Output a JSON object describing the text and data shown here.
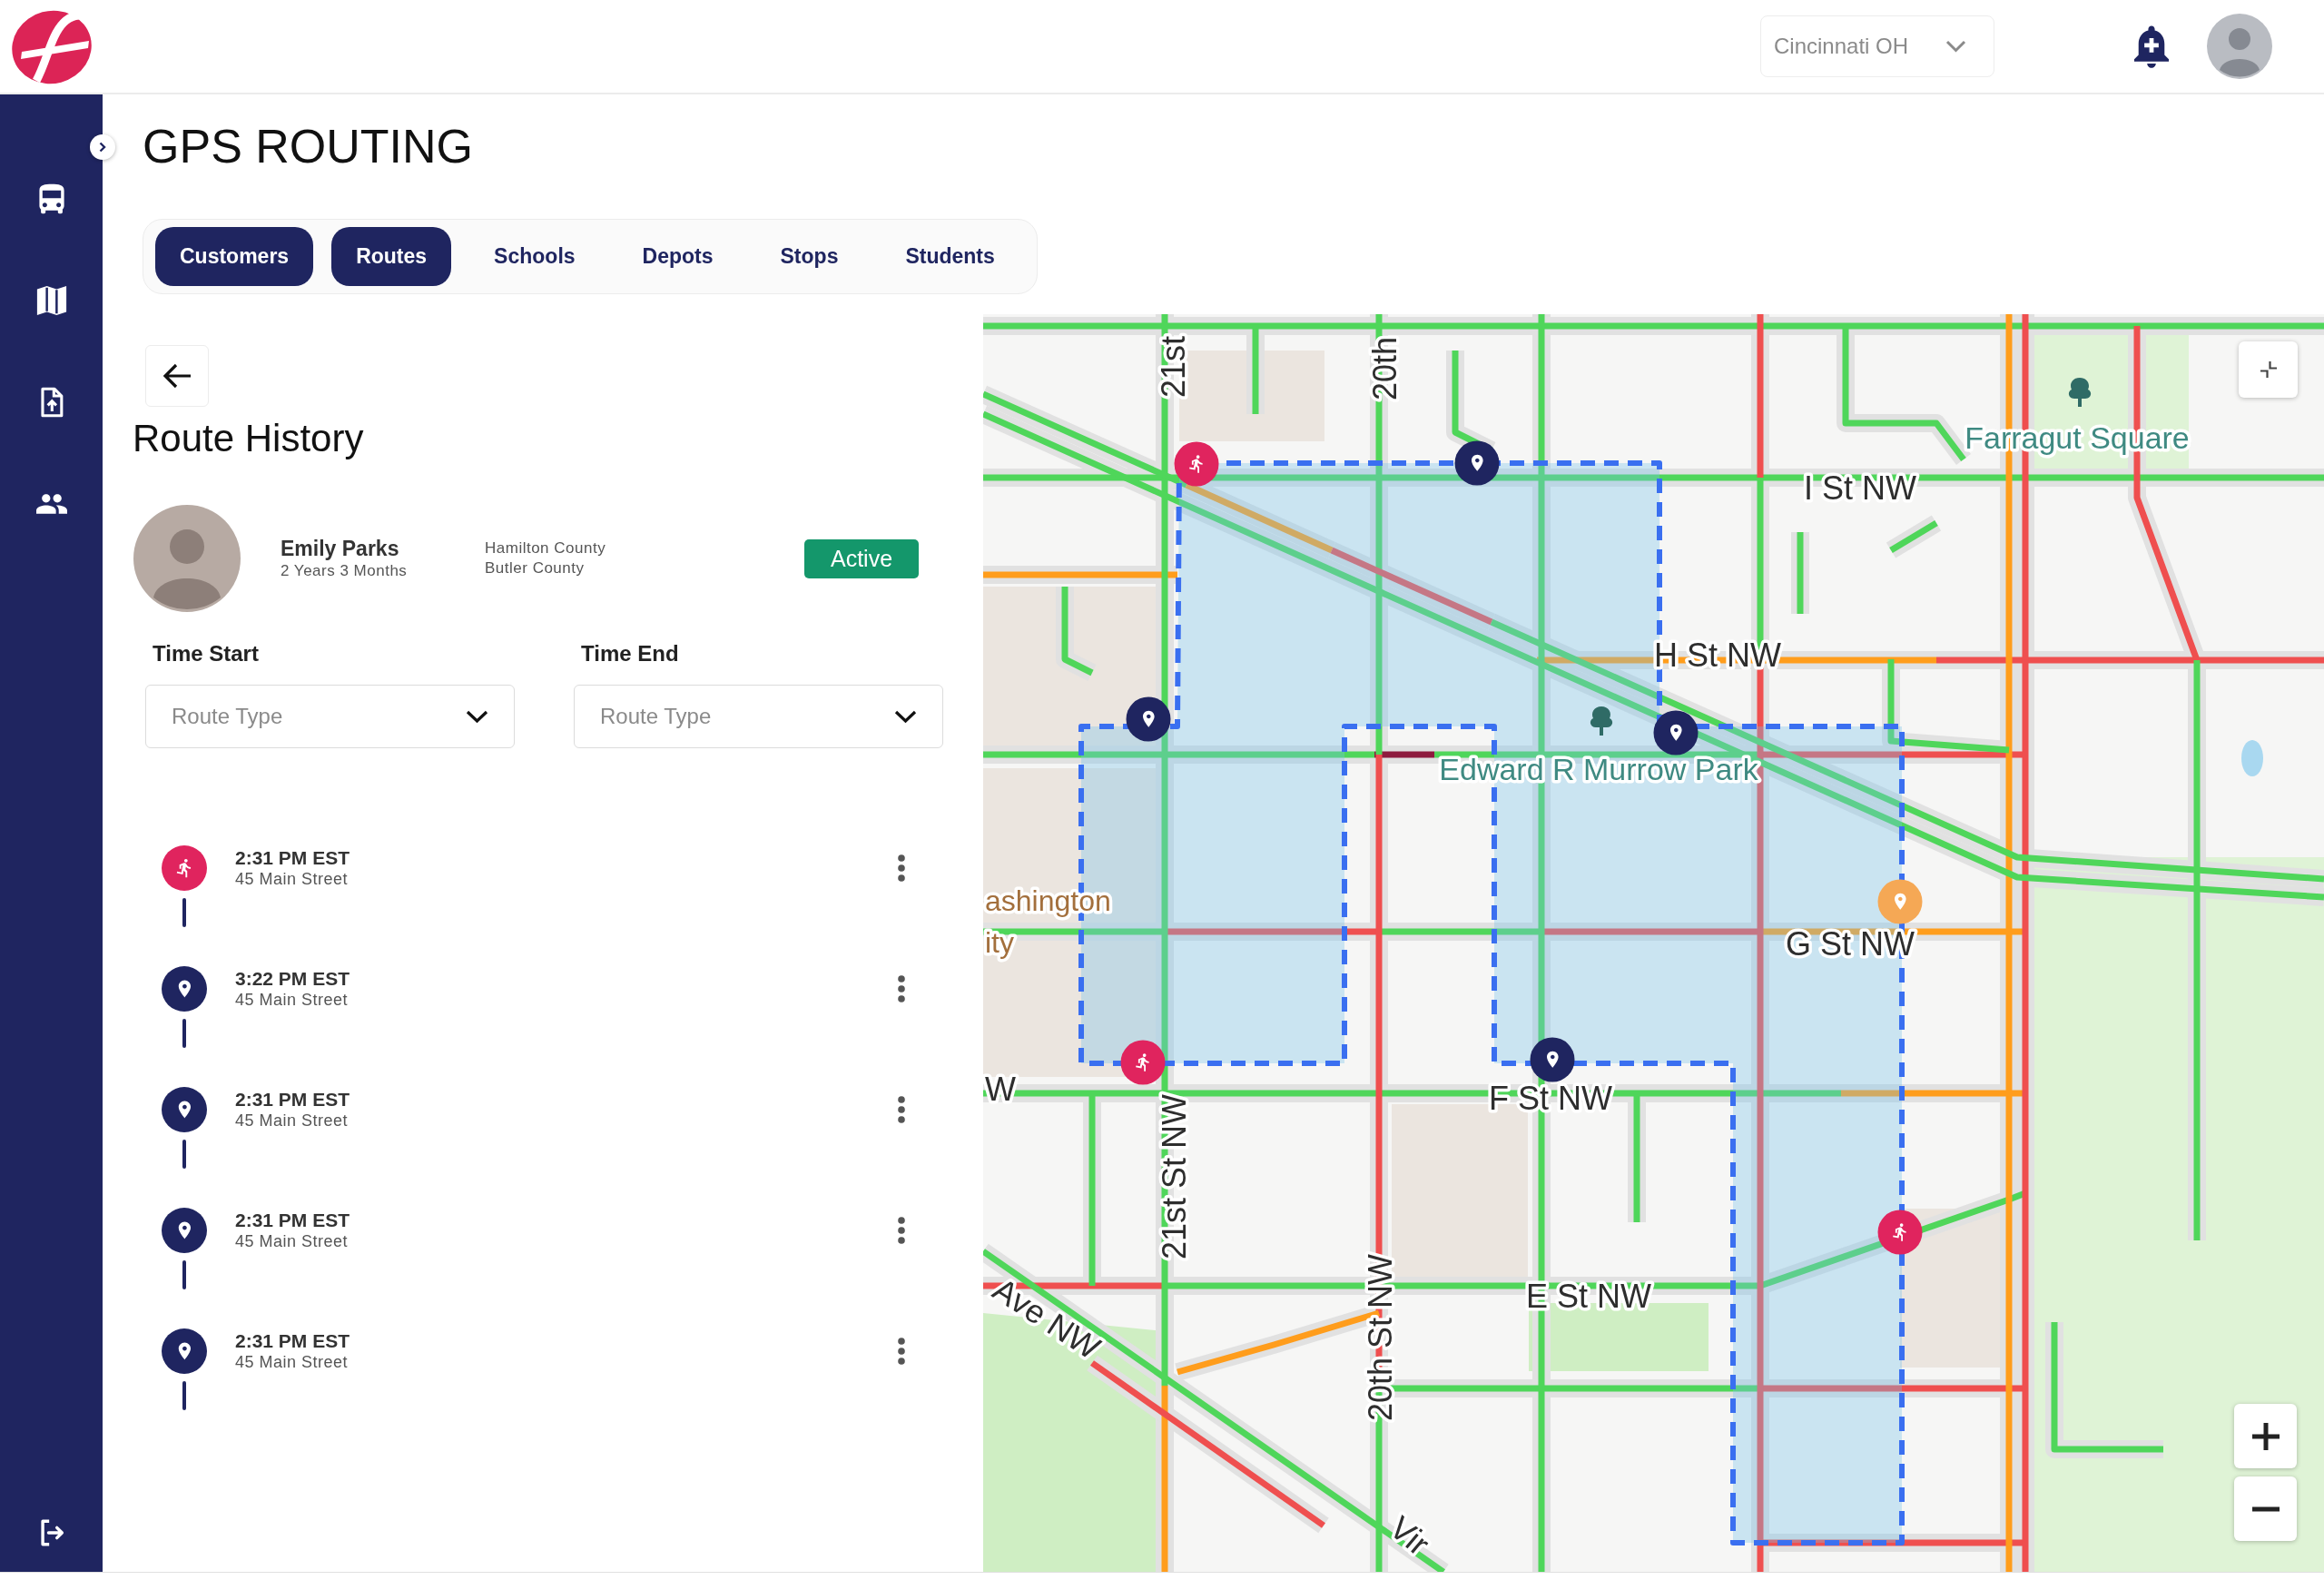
{
  "header": {
    "location": {
      "value": "Cincinnati OH"
    }
  },
  "page": {
    "title": "GPS ROUTING"
  },
  "tabs": [
    {
      "label": "Customers",
      "selected": true
    },
    {
      "label": "Routes",
      "selected": true
    },
    {
      "label": "Schools",
      "selected": false
    },
    {
      "label": "Depots",
      "selected": false
    },
    {
      "label": "Stops",
      "selected": false
    },
    {
      "label": "Students",
      "selected": false
    }
  ],
  "route_history": {
    "title": "Route History",
    "driver": {
      "name": "Emily Parks",
      "tenure": "2 Years 3 Months",
      "counties": [
        "Hamilton County",
        "Butler County"
      ],
      "status": {
        "label": "Active",
        "kind": "active"
      }
    },
    "filters": [
      {
        "label": "Time Start",
        "placeholder": "Route Type"
      },
      {
        "label": "Time End",
        "placeholder": "Route Type"
      }
    ],
    "timeline": [
      {
        "kind": "pickup",
        "time": "2:31 PM EST",
        "address": "45 Main Street"
      },
      {
        "kind": "stop",
        "time": "3:22 PM EST",
        "address": "45 Main Street"
      },
      {
        "kind": "stop",
        "time": "2:31 PM EST",
        "address": "45 Main Street"
      },
      {
        "kind": "stop",
        "time": "2:31 PM EST",
        "address": "45 Main Street"
      },
      {
        "kind": "stop",
        "time": "2:31 PM EST",
        "address": "45 Main Street"
      }
    ]
  },
  "map": {
    "labels": [
      {
        "text": "21st",
        "kind": "street"
      },
      {
        "text": "20th",
        "kind": "street"
      },
      {
        "text": "Farragut Square",
        "kind": "park"
      },
      {
        "text": "I St NW",
        "kind": "street"
      },
      {
        "text": "H St NW",
        "kind": "street"
      },
      {
        "text": "Edward R Murrow Park",
        "kind": "park"
      },
      {
        "text": "ashington",
        "kind": "place"
      },
      {
        "text": "ity",
        "kind": "place"
      },
      {
        "text": "G St NW",
        "kind": "street"
      },
      {
        "text": "W",
        "kind": "street"
      },
      {
        "text": "F St NW",
        "kind": "street"
      },
      {
        "text": "21st St NW",
        "kind": "street"
      },
      {
        "text": "E St NW",
        "kind": "street"
      },
      {
        "text": "20th St NW",
        "kind": "street"
      },
      {
        "text": "Ave NW",
        "kind": "street"
      },
      {
        "text": "Vir",
        "kind": "street"
      }
    ],
    "markers": [
      {
        "kind": "pickup",
        "color": "#e0245e"
      },
      {
        "kind": "stop",
        "color": "#1f2560"
      },
      {
        "kind": "stop",
        "color": "#1f2560"
      },
      {
        "kind": "stop",
        "color": "#1f2560"
      },
      {
        "kind": "stop",
        "color": "#f5a855"
      },
      {
        "kind": "pickup",
        "color": "#e0245e"
      },
      {
        "kind": "stop",
        "color": "#1f2560"
      },
      {
        "kind": "pickup",
        "color": "#e0245e"
      }
    ]
  }
}
